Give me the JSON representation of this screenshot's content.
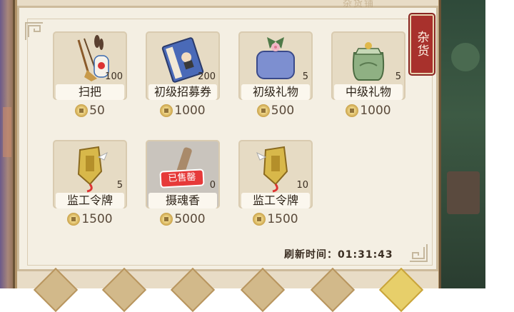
{
  "shop": {
    "category_label": "杂货",
    "header_faded": "杂货铺",
    "refresh_label": "刷新时间：",
    "refresh_time": "01:31:43",
    "items": [
      {
        "name": "扫把",
        "count": "100",
        "price": "50",
        "icon": "broom-icon",
        "sold": false
      },
      {
        "name": "初级招募券",
        "count": "200",
        "price": "1000",
        "icon": "recruit-book-icon",
        "sold": false
      },
      {
        "name": "初级礼物",
        "count": "5",
        "price": "500",
        "icon": "gift-box-icon",
        "sold": false
      },
      {
        "name": "中级礼物",
        "count": "5",
        "price": "1000",
        "icon": "gift-bag-icon",
        "sold": false
      },
      {
        "name": "监工令牌",
        "count": "5",
        "price": "1500",
        "icon": "token-icon",
        "sold": false
      },
      {
        "name": "摄魂香",
        "count": "0",
        "price": "5000",
        "icon": "incense-icon",
        "sold": true,
        "sold_label": "已售罄"
      },
      {
        "name": "监工令牌",
        "count": "10",
        "price": "1500",
        "icon": "token-icon",
        "sold": false
      }
    ]
  },
  "colors": {
    "panel_bg": "#f4efe3",
    "card_bg": "#e6dbc4",
    "sold_badge": "#e63a3a",
    "category_tag": "#a8312c"
  }
}
